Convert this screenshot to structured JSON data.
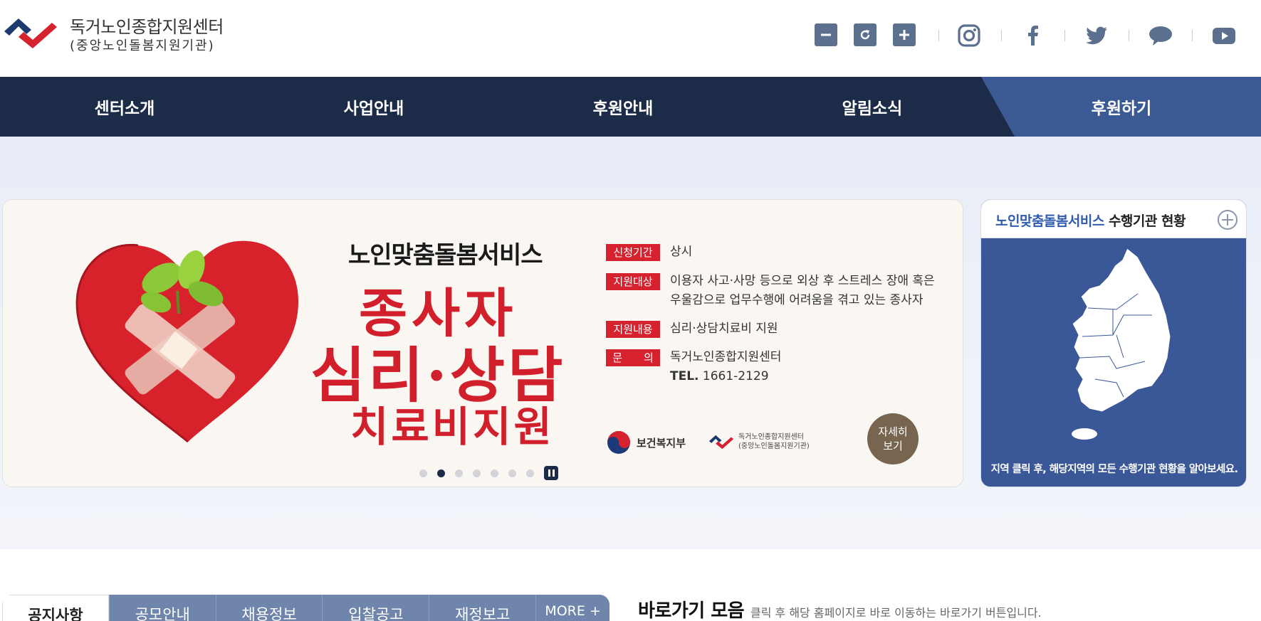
{
  "header": {
    "title": "독거노인종합지원센터",
    "subtitle": "(중앙노인돌봄지원기관)"
  },
  "toolbar": {
    "zoom_out_icon": "minus-icon",
    "reset_icon": "refresh-icon",
    "zoom_in_icon": "plus-icon",
    "sns": [
      "instagram-icon",
      "facebook-icon",
      "twitter-icon",
      "chat-icon",
      "youtube-icon"
    ]
  },
  "nav": {
    "items": [
      {
        "label": "센터소개"
      },
      {
        "label": "사업안내"
      },
      {
        "label": "후원안내"
      },
      {
        "label": "알림소식"
      }
    ],
    "donate": "후원하기"
  },
  "banner": {
    "slogan_top": "노인맞춤돌봄서비스",
    "slogan_1": "종사자",
    "slogan_2": "심리·상담",
    "slogan_3": "치료비지원",
    "rows": [
      {
        "tag": "신청기간",
        "text": "상시"
      },
      {
        "tag": "지원대상",
        "text": "이용자 사고·사망 등으로 외상 후 스트레스 장애 혹은",
        "text2": "우울감으로 업무수행에 어려움을 겪고 있는 종사자"
      },
      {
        "tag": "지원내용",
        "text": "심리·상담치료비 지원"
      },
      {
        "tag": "문　　의",
        "text": "독거노인종합지원센터",
        "tel_label": "TEL.",
        "tel": "1661-2129"
      }
    ],
    "ministry": "보건복지부",
    "center_line1": "독거노인종합지원센터",
    "center_line2": "(중앙노인돌봄지원기관)",
    "more_line1": "자세히",
    "more_line2": "보기",
    "slide_count": 7,
    "active_slide": 2
  },
  "mapbox": {
    "title_highlight": "노인맞춤돌봄서비스",
    "title_rest": " 수행기관 현황",
    "caption": "지역 클릭 후, 해당지역의 모든 수행기관 현황을 알아보세요."
  },
  "tabs": {
    "items": [
      {
        "label": "공지사항",
        "active": true
      },
      {
        "label": "공모안내"
      },
      {
        "label": "채용정보"
      },
      {
        "label": "입찰공고"
      },
      {
        "label": "재정보고"
      }
    ],
    "more": "MORE +"
  },
  "shortcuts": {
    "title": "바로가기 모음",
    "desc": "클릭 후 해당 홈페이지로 바로 이동하는 바로가기 버튼입니다."
  },
  "colors": {
    "navy": "#1c2b47",
    "donate_blue": "#3b5a93",
    "accent_red": "#d6222f",
    "map_blue": "#3a5797"
  }
}
